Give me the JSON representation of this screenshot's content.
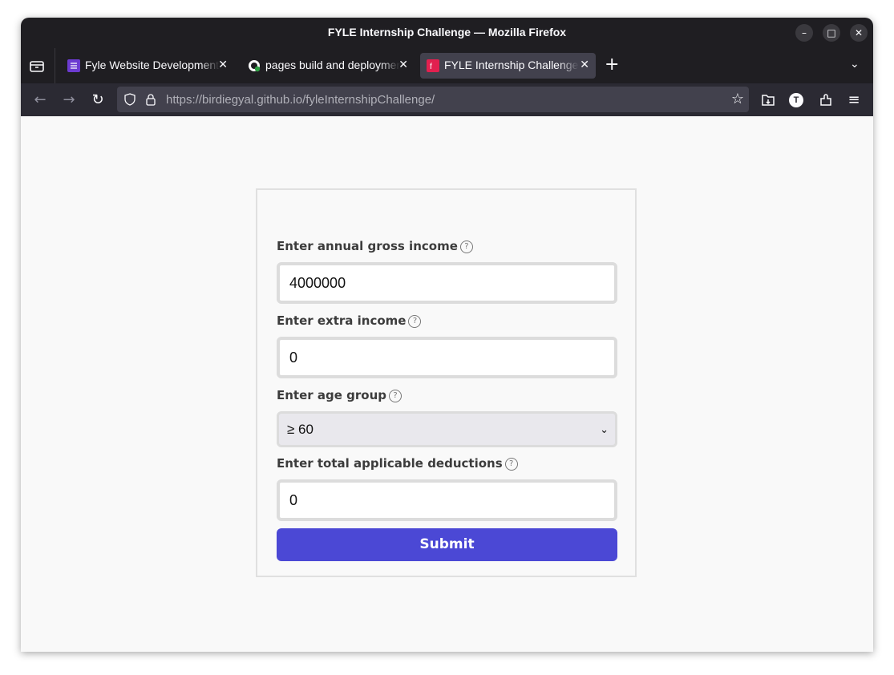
{
  "window": {
    "title": "FYLE Internship Challenge — Mozilla Firefox",
    "controls": {
      "minimize": "–",
      "maximize": "□",
      "close": "✕"
    }
  },
  "tabs": [
    {
      "label": "Fyle Website Development",
      "favicon_color": "#6c3bd1",
      "active": false
    },
    {
      "label": "pages build and deployment",
      "favicon_color": "#ffffff",
      "active": false
    },
    {
      "label": "FYLE Internship Challenge",
      "favicon_color": "#e2204f",
      "active": true
    }
  ],
  "toolbar": {
    "new_tab": "+",
    "tabs_menu": "⌄",
    "url_host": "https://birdiegyal.github.io/",
    "url_path": "fyleInternshipChallenge/",
    "profile_initial": "T"
  },
  "form": {
    "fields": [
      {
        "label": "Enter annual gross income",
        "value": "4000000"
      },
      {
        "label": "Enter extra income",
        "value": "0"
      },
      {
        "label": "Enter age group",
        "value": "≥ 60"
      },
      {
        "label": "Enter total applicable deductions",
        "value": "0"
      }
    ],
    "help_glyph": "?",
    "submit_label": "Submit",
    "accent_color": "#4b48d5"
  }
}
